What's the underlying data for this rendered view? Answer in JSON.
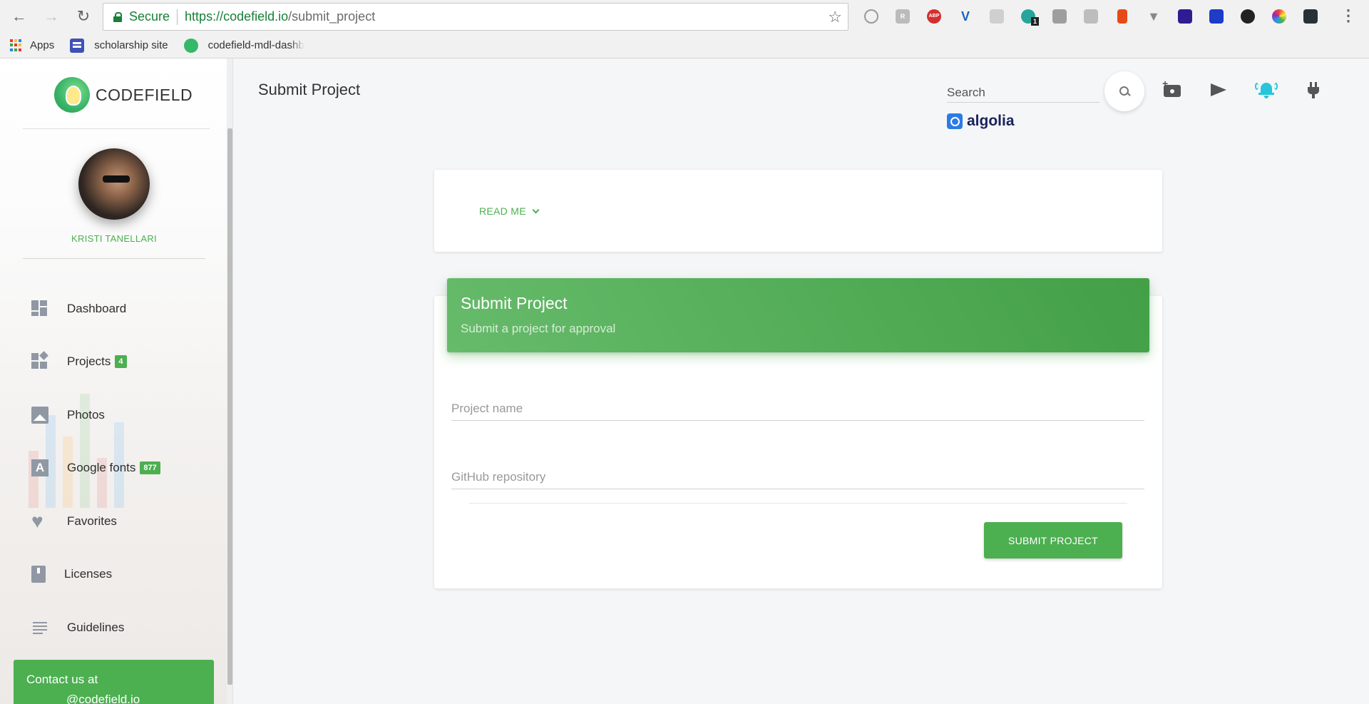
{
  "browser": {
    "secure_label": "Secure",
    "url_host": "https://codefield.io",
    "url_path": "/submit_project",
    "bookmarks": [
      {
        "label": "Apps"
      },
      {
        "label": "scholarship site"
      },
      {
        "label": "codefield-mdl-dashb"
      }
    ],
    "extensions": [
      "circle-ext",
      "r-ext",
      "abp-ext",
      "v-ext",
      "camera-ext",
      "eye-ext",
      "grid-ext",
      "window-ext",
      "doc-ext",
      "triangle-ext",
      "moon-ext",
      "blue-ext",
      "flame-ext",
      "color-wheel-ext",
      "dark-ext"
    ],
    "eye_ext_badge": "1"
  },
  "sidebar": {
    "brand_name": "CODEFIELD",
    "user_name": "KRISTI TANELLARI",
    "items": [
      {
        "label": "Dashboard",
        "icon": "dashboard-icon"
      },
      {
        "label": "Projects",
        "icon": "projects-icon",
        "badge": "4"
      },
      {
        "label": "Photos",
        "icon": "photo-icon"
      },
      {
        "label": "Google fonts",
        "icon": "font-icon",
        "badge": "877"
      },
      {
        "label": "Favorites",
        "icon": "heart-icon"
      },
      {
        "label": "Licenses",
        "icon": "book-icon"
      },
      {
        "label": "Guidelines",
        "icon": "lines-icon"
      }
    ],
    "contact_title": "Contact us at",
    "contact_email": "@codefield.io"
  },
  "header": {
    "page_title": "Submit Project",
    "search_placeholder": "Search",
    "algolia_label": "algolia"
  },
  "readme": {
    "label": "READ ME"
  },
  "form": {
    "title": "Submit Project",
    "subtitle": "Submit a project for approval",
    "project_name_placeholder": "Project name",
    "github_placeholder": "GitHub repository",
    "submit_label": "SUBMIT PROJECT"
  },
  "colors": {
    "accent": "#4caf50",
    "notification": "#26c6da"
  }
}
